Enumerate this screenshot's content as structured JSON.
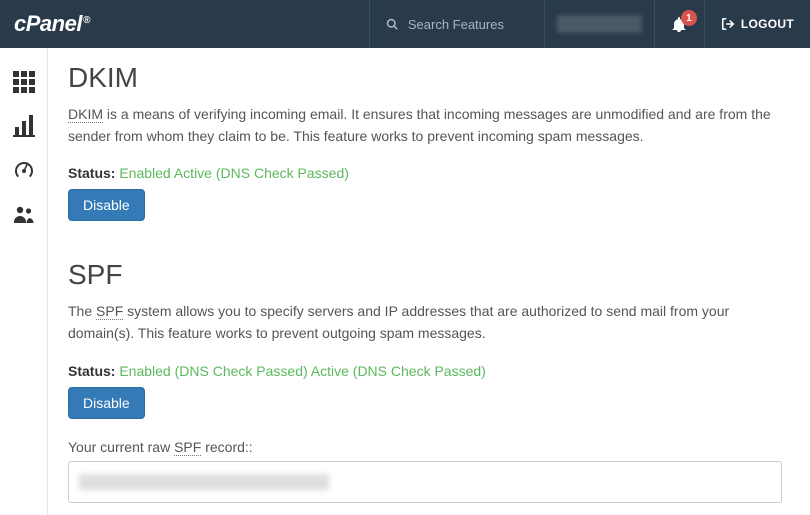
{
  "header": {
    "logo_text": "cPanel",
    "search_placeholder": "Search Features",
    "notification_count": "1",
    "logout_label": "LOGOUT"
  },
  "sections": {
    "dkim": {
      "title": "DKIM",
      "abbr": "DKIM",
      "desc_rest": " is a means of verifying incoming email. It ensures that incoming messages are unmodified and are from the sender from whom they claim to be. This feature works to prevent incoming spam messages.",
      "status_label": "Status:",
      "status_value": "Enabled Active (DNS Check Passed)",
      "button": "Disable"
    },
    "spf": {
      "title": "SPF",
      "desc_pre": "The ",
      "abbr": "SPF",
      "desc_rest": " system allows you to specify servers and IP addresses that are authorized to send mail from your domain(s). This feature works to prevent outgoing spam messages.",
      "status_label": "Status:",
      "status_value": "Enabled (DNS Check Passed) Active (DNS Check Passed)",
      "button": "Disable",
      "record_label_pre": "Your current raw ",
      "record_abbr": "SPF",
      "record_label_post": " record::"
    }
  }
}
